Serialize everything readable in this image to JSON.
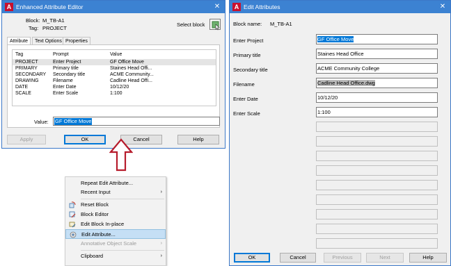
{
  "left_window": {
    "title": "Enhanced Attribute Editor",
    "block_label": "Block:",
    "block_value": "M_TB-A1",
    "tag_label": "Tag:",
    "tag_value": "PROJECT",
    "select_block_label": "Select block",
    "tabs": [
      {
        "label": "Attribute",
        "active": true
      },
      {
        "label": "Text Options",
        "active": false
      },
      {
        "label": "Properties",
        "active": false
      }
    ],
    "columns": [
      "Tag",
      "Prompt",
      "Value"
    ],
    "rows": [
      {
        "tag": "PROJECT",
        "prompt": "Enter Project",
        "value": "GF Office Move",
        "selected": true
      },
      {
        "tag": "PRIMARY",
        "prompt": "Primary title",
        "value": "Staines Head Offi..."
      },
      {
        "tag": "SECONDARY",
        "prompt": "Secondary title",
        "value": "ACME Community..."
      },
      {
        "tag": "DRAWING",
        "prompt": "Filename",
        "value": "Cadline Head Offi..."
      },
      {
        "tag": "DATE",
        "prompt": "Enter Date",
        "value": "10/12/20"
      },
      {
        "tag": "SCALE",
        "prompt": "Enter Scale",
        "value": "1:100"
      }
    ],
    "value_label": "Value:",
    "value_text": "GF Office Move",
    "buttons": {
      "apply": "Apply",
      "ok": "OK",
      "cancel": "Cancel",
      "help": "Help"
    },
    "close_glyph": "✕",
    "app_glyph": "A"
  },
  "right_window": {
    "title": "Edit Attributes",
    "block_name_label": "Block name:",
    "block_name_value": "M_TB-A1",
    "fields": [
      {
        "label": "Enter Project",
        "value": "GF Office Move",
        "highlight": "blue"
      },
      {
        "label": "Primary title",
        "value": "Staines Head Office"
      },
      {
        "label": "Secondary title",
        "value": "ACME Community College"
      },
      {
        "label": "Filename",
        "value": "Cadline Head Office.dwg",
        "highlight": "gray"
      },
      {
        "label": "Enter Date",
        "value": "10/12/20"
      },
      {
        "label": "Enter Scale",
        "value": "1:100"
      }
    ],
    "buttons": {
      "ok": "OK",
      "cancel": "Cancel",
      "previous": "Previous",
      "next": "Next",
      "help": "Help"
    },
    "close_glyph": "✕",
    "app_glyph": "A"
  },
  "context_menu": {
    "items": [
      {
        "label": "Repeat Edit Attribute...",
        "icon": null
      },
      {
        "label": "Recent Input",
        "submenu": true
      },
      {
        "separator": true
      },
      {
        "label": "Reset Block",
        "icon": "reset-block-icon"
      },
      {
        "label": "Block Editor",
        "icon": "block-editor-icon"
      },
      {
        "label": "Edit Block In-place",
        "icon": "edit-block-in-place-icon"
      },
      {
        "label": "Edit Attribute...",
        "icon": "edit-attribute-icon",
        "selected": true
      },
      {
        "label": "Annotative Object Scale",
        "submenu": true,
        "disabled": true
      },
      {
        "separator": true
      },
      {
        "label": "Clipboard",
        "submenu": true
      }
    ],
    "submenu_glyph": "›"
  },
  "colors": {
    "title_bar": "#3c82d2",
    "selection_blue": "#0078d7",
    "arrow_red": "#b71c2c",
    "autocad_red": "#c8102e"
  }
}
